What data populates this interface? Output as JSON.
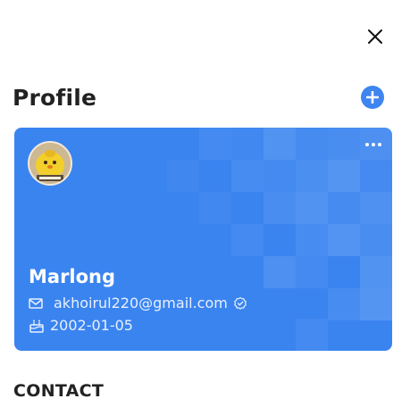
{
  "header": {
    "title": "Profile",
    "close_icon": "close-icon",
    "add_icon": "plus-circle-icon"
  },
  "profile_card": {
    "name": "Marlong",
    "email": "akhoirul220@gmail.com",
    "birth_date": "2002-01-05",
    "accent_color": "#3a84f0",
    "avatar_icon": "avatar-image",
    "more_icon": "more-horizontal-icon",
    "email_icon": "mail-icon",
    "verified_icon": "verified-check-icon",
    "birthday_icon": "cake-icon"
  },
  "contact": {
    "title": "CONTACT"
  }
}
